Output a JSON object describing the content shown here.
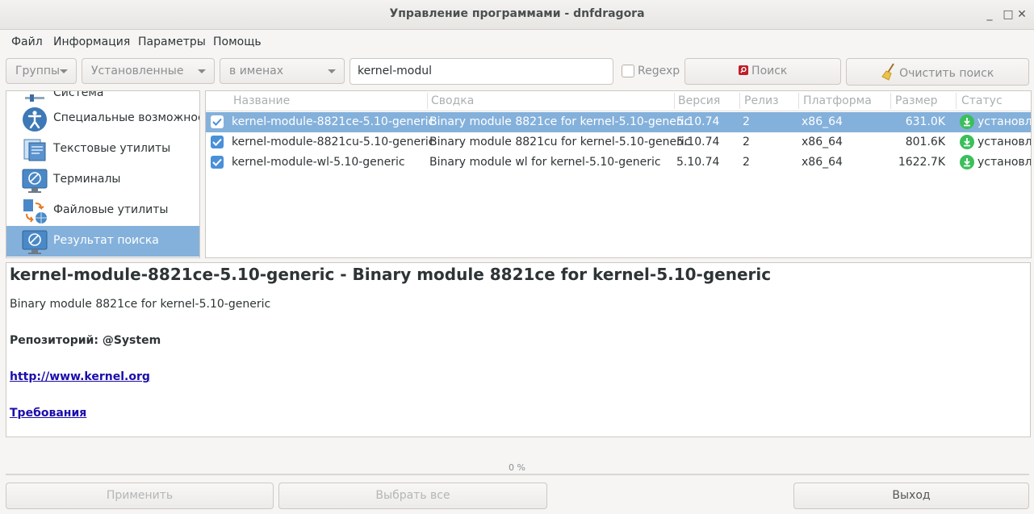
{
  "window": {
    "title": "Управление программами - dnfdragora",
    "minimize": "_",
    "maximize": "□",
    "close": "✕"
  },
  "menu": [
    "Файл",
    "Информация",
    "Параметры",
    "Помощь"
  ],
  "toolbar": {
    "groups": "Группы",
    "filter": "Установленные",
    "search_in": "в именах",
    "search_value": "kernel-modul",
    "regexp": "Regexp",
    "regexp_checked": false,
    "search_button": "Поиск",
    "clear_button": "Очистить поиск"
  },
  "sidebar": {
    "partial_top": "Система",
    "items": [
      {
        "label": "Специальные возможности",
        "icon": "accessibility-icon"
      },
      {
        "label": "Текстовые утилиты",
        "icon": "text-tools-icon"
      },
      {
        "label": "Терминалы",
        "icon": "terminal-icon"
      },
      {
        "label": "Файловые утилиты",
        "icon": "file-tools-icon"
      },
      {
        "label": "Результат поиска",
        "icon": "search-result-icon",
        "selected": true
      }
    ]
  },
  "table": {
    "columns": [
      "Название",
      "Сводка",
      "Версия",
      "Релиз",
      "Платформа",
      "Размер",
      "Статус"
    ],
    "rows": [
      {
        "name": "kernel-module-8821ce-5.10-generic",
        "summary": "Binary module 8821ce for kernel-5.10-generic",
        "version": "5.10.74",
        "release": "2",
        "arch": "x86_64",
        "size": "631.0K",
        "status": "установлен",
        "checked": true,
        "selected": true
      },
      {
        "name": "kernel-module-8821cu-5.10-generic",
        "summary": "Binary module 8821cu for kernel-5.10-generic",
        "version": "5.10.74",
        "release": "2",
        "arch": "x86_64",
        "size": "801.6K",
        "status": "установлен",
        "checked": true,
        "selected": false
      },
      {
        "name": "kernel-module-wl-5.10-generic",
        "summary": "Binary module wl for kernel-5.10-generic",
        "version": "5.10.74",
        "release": "2",
        "arch": "x86_64",
        "size": "1622.7K",
        "status": "установлен",
        "checked": true,
        "selected": false
      }
    ]
  },
  "details": {
    "heading": "kernel-module-8821ce-5.10-generic - Binary module 8821ce for kernel-5.10-generic",
    "description": "Binary module 8821ce for kernel-5.10-generic",
    "repository": "Репозиторий: @System",
    "url": "http://www.kernel.org",
    "requirements": "Требования"
  },
  "progress": {
    "label": "0 %",
    "value": 0
  },
  "buttons": {
    "apply": "Применить",
    "select_all": "Выбрать все",
    "quit": "Выход"
  },
  "colors": {
    "selection": "#84b1db",
    "accent": "#4a90d9",
    "installed": "#3bbf5b"
  }
}
